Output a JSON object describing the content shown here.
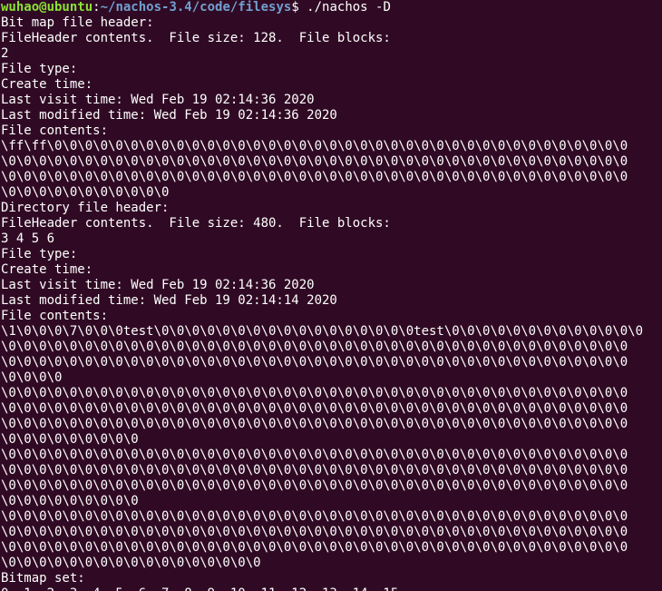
{
  "prompt": {
    "user_host": "wuhao@ubuntu",
    "colon": ":",
    "path": "~/nachos-3.4/code/filesys",
    "symbol": "$ ",
    "command": "./nachos -D"
  },
  "lines": [
    "Bit map file header:",
    "FileHeader contents.  File size: 128.  File blocks:",
    "2",
    "File type:",
    "Create time:",
    "Last visit time: Wed Feb 19 02:14:36 2020",
    "Last modified time: Wed Feb 19 02:14:36 2020",
    "File contents:",
    "\\ff\\ff\\0\\0\\0\\0\\0\\0\\0\\0\\0\\0\\0\\0\\0\\0\\0\\0\\0\\0\\0\\0\\0\\0\\0\\0\\0\\0\\0\\0\\0\\0\\0\\0\\0\\0\\0\\0\\0\\0",
    "\\0\\0\\0\\0\\0\\0\\0\\0\\0\\0\\0\\0\\0\\0\\0\\0\\0\\0\\0\\0\\0\\0\\0\\0\\0\\0\\0\\0\\0\\0\\0\\0\\0\\0\\0\\0\\0\\0\\0\\0\\0",
    "\\0\\0\\0\\0\\0\\0\\0\\0\\0\\0\\0\\0\\0\\0\\0\\0\\0\\0\\0\\0\\0\\0\\0\\0\\0\\0\\0\\0\\0\\0\\0\\0\\0\\0\\0\\0\\0\\0\\0\\0\\0",
    "\\0\\0\\0\\0\\0\\0\\0\\0\\0\\0\\0",
    "Directory file header:",
    "FileHeader contents.  File size: 480.  File blocks:",
    "3 4 5 6",
    "File type:",
    "Create time:",
    "Last visit time: Wed Feb 19 02:14:36 2020",
    "Last modified time: Wed Feb 19 02:14:14 2020",
    "File contents:",
    "\\1\\0\\0\\0\\7\\0\\0\\0test\\0\\0\\0\\0\\0\\0\\0\\0\\0\\0\\0\\0\\0\\0\\0\\0\\0test\\0\\0\\0\\0\\0\\0\\0\\0\\0\\0\\0\\0\\0",
    "\\0\\0\\0\\0\\0\\0\\0\\0\\0\\0\\0\\0\\0\\0\\0\\0\\0\\0\\0\\0\\0\\0\\0\\0\\0\\0\\0\\0\\0\\0\\0\\0\\0\\0\\0\\0\\0\\0\\0\\0\\0",
    "\\0\\0\\0\\0\\0\\0\\0\\0\\0\\0\\0\\0\\0\\0\\0\\0\\0\\0\\0\\0\\0\\0\\0\\0\\0\\0\\0\\0\\0\\0\\0\\0\\0\\0\\0\\0\\0\\0\\0\\0\\0",
    "\\0\\0\\0\\0",
    "\\0\\0\\0\\0\\0\\0\\0\\0\\0\\0\\0\\0\\0\\0\\0\\0\\0\\0\\0\\0\\0\\0\\0\\0\\0\\0\\0\\0\\0\\0\\0\\0\\0\\0\\0\\0\\0\\0\\0\\0\\0",
    "\\0\\0\\0\\0\\0\\0\\0\\0\\0\\0\\0\\0\\0\\0\\0\\0\\0\\0\\0\\0\\0\\0\\0\\0\\0\\0\\0\\0\\0\\0\\0\\0\\0\\0\\0\\0\\0\\0\\0\\0\\0",
    "\\0\\0\\0\\0\\0\\0\\0\\0\\0\\0\\0\\0\\0\\0\\0\\0\\0\\0\\0\\0\\0\\0\\0\\0\\0\\0\\0\\0\\0\\0\\0\\0\\0\\0\\0\\0\\0\\0\\0\\0\\0",
    "\\0\\0\\0\\0\\0\\0\\0\\0\\0",
    "\\0\\0\\0\\0\\0\\0\\0\\0\\0\\0\\0\\0\\0\\0\\0\\0\\0\\0\\0\\0\\0\\0\\0\\0\\0\\0\\0\\0\\0\\0\\0\\0\\0\\0\\0\\0\\0\\0\\0\\0\\0",
    "\\0\\0\\0\\0\\0\\0\\0\\0\\0\\0\\0\\0\\0\\0\\0\\0\\0\\0\\0\\0\\0\\0\\0\\0\\0\\0\\0\\0\\0\\0\\0\\0\\0\\0\\0\\0\\0\\0\\0\\0\\0",
    "\\0\\0\\0\\0\\0\\0\\0\\0\\0\\0\\0\\0\\0\\0\\0\\0\\0\\0\\0\\0\\0\\0\\0\\0\\0\\0\\0\\0\\0\\0\\0\\0\\0\\0\\0\\0\\0\\0\\0\\0\\0",
    "\\0\\0\\0\\0\\0\\0\\0\\0\\0",
    "\\0\\0\\0\\0\\0\\0\\0\\0\\0\\0\\0\\0\\0\\0\\0\\0\\0\\0\\0\\0\\0\\0\\0\\0\\0\\0\\0\\0\\0\\0\\0\\0\\0\\0\\0\\0\\0\\0\\0\\0\\0",
    "\\0\\0\\0\\0\\0\\0\\0\\0\\0\\0\\0\\0\\0\\0\\0\\0\\0\\0\\0\\0\\0\\0\\0\\0\\0\\0\\0\\0\\0\\0\\0\\0\\0\\0\\0\\0\\0\\0\\0\\0\\0",
    "\\0\\0\\0\\0\\0\\0\\0\\0\\0\\0\\0\\0\\0\\0\\0\\0\\0\\0\\0\\0\\0\\0\\0\\0\\0\\0\\0\\0\\0\\0\\0\\0\\0\\0\\0\\0\\0\\0\\0\\0\\0",
    "\\0\\0\\0\\0\\0\\0\\0\\0\\0\\0\\0\\0\\0\\0\\0\\0\\0",
    "Bitmap set:",
    "0, 1, 2, 3, 4, 5, 6, 7, 8, 9, 10, 11, 12, 13, 14, 15,"
  ]
}
